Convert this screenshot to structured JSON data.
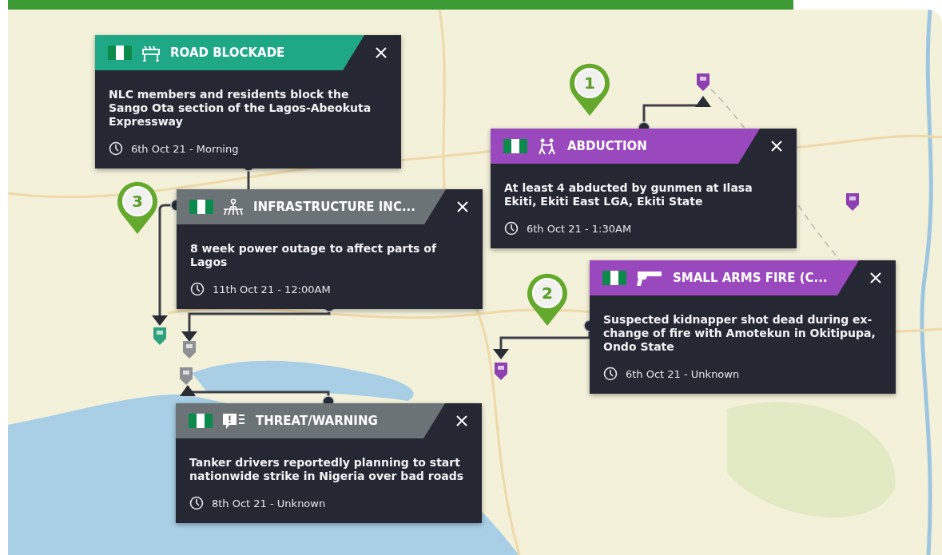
{
  "cards": [
    {
      "kind": "blockade",
      "color": "#1ea886",
      "title": "ROAD BLOCKADE",
      "description": "NLC members and residents block the Sango Ota section of the Lagos-Abeokuta Expressway",
      "time": "6th Oct 21 - Morning"
    },
    {
      "kind": "abduction",
      "color": "#9a48bd",
      "title": "ABDUCTION",
      "description": "At least 4 abducted by gunmen at Ilasa Ekiti, Ekiti East LGA, Ekiti State",
      "time": "6th Oct 21 - 1:30AM"
    },
    {
      "kind": "infrastructure",
      "color": "#6b7377",
      "title": "INFRASTRUCTURE INC...",
      "description": "8 week power outage to affect parts of Lagos",
      "time": "11th Oct 21 - 12:00AM"
    },
    {
      "kind": "gunfire",
      "color": "#9a48bd",
      "title": "SMALL ARMS FIRE (C...",
      "description": "Suspected kidnapper shot dead during ex-change of fire with Amotekun in Okitipupa, Ondo State",
      "time": "6th Oct 21 - Unknown"
    },
    {
      "kind": "warning",
      "color": "#6b7377",
      "title": "THREAT/WARNING",
      "description": "Tanker drivers reportedly planning to start nationwide strike in Nigeria over bad roads",
      "time": "8th Oct 21 - Unknown"
    }
  ],
  "pins": [
    {
      "label": "1"
    },
    {
      "label": "2"
    },
    {
      "label": "3"
    }
  ]
}
